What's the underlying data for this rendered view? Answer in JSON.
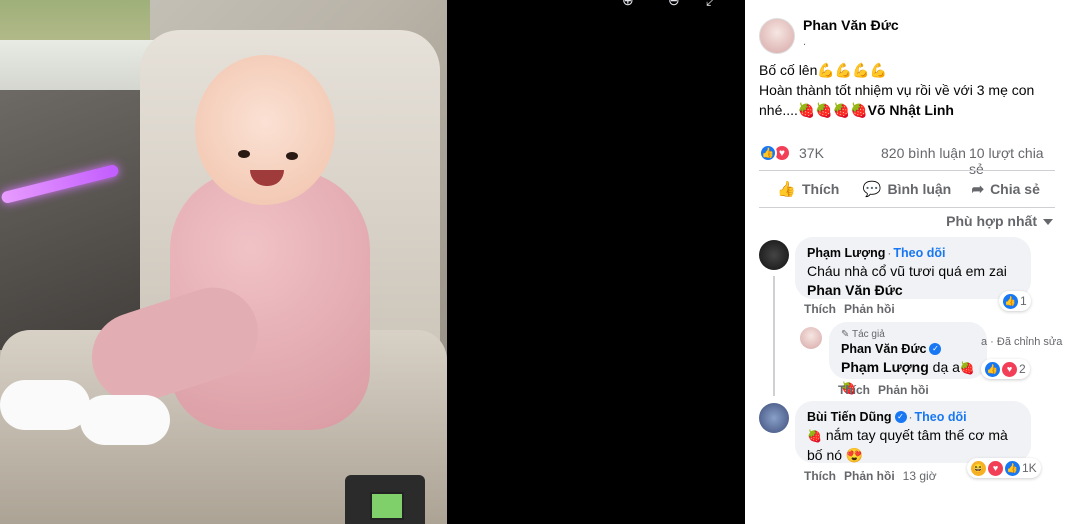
{
  "post": {
    "author": "Phan Văn Đức",
    "author_sub": ".",
    "line1": "Bố cố lên💪💪💪💪",
    "line2": "Hoàn thành tốt nhiệm vụ rồi về với 3 mẹ con nhé....🍓🍓🍓🍓",
    "tag": "Võ Nhật Linh",
    "reactions_count": "37K",
    "comments_count": "820 bình luận",
    "shares_count": "10 lượt chia sẻ"
  },
  "actions": {
    "like": "Thích",
    "comment": "Bình luận",
    "share": "Chia sẻ"
  },
  "sort_label": "Phù hợp nhất",
  "comments": [
    {
      "name": "Phạm Lượng",
      "follow": "Theo dõi",
      "text": "Cháu nhà cổ vũ tươi quá em zai",
      "mention": "Phan Văn Đức",
      "like": "Thích",
      "reply": "Phản hồi",
      "react_count": "1"
    },
    {
      "badge": "Tác giả",
      "name": "Phan Văn Đức",
      "mention": "Phạm Lượng",
      "text": "dạ a",
      "edited": "Đã chỉnh sửa",
      "like": "Thích",
      "reply": "Phản hồi",
      "react_count": "2"
    },
    {
      "name": "Bùi Tiến Dũng",
      "follow": "Theo dõi",
      "text": "nắm tay quyết tâm thế cơ mà bố nó 😍",
      "like": "Thích",
      "reply": "Phản hồi",
      "time": "13 giờ",
      "react_count": "1K"
    }
  ],
  "colors": {
    "accent": "#1877f2",
    "love": "#f33e58",
    "text": "#050505",
    "muted": "#65676b"
  }
}
